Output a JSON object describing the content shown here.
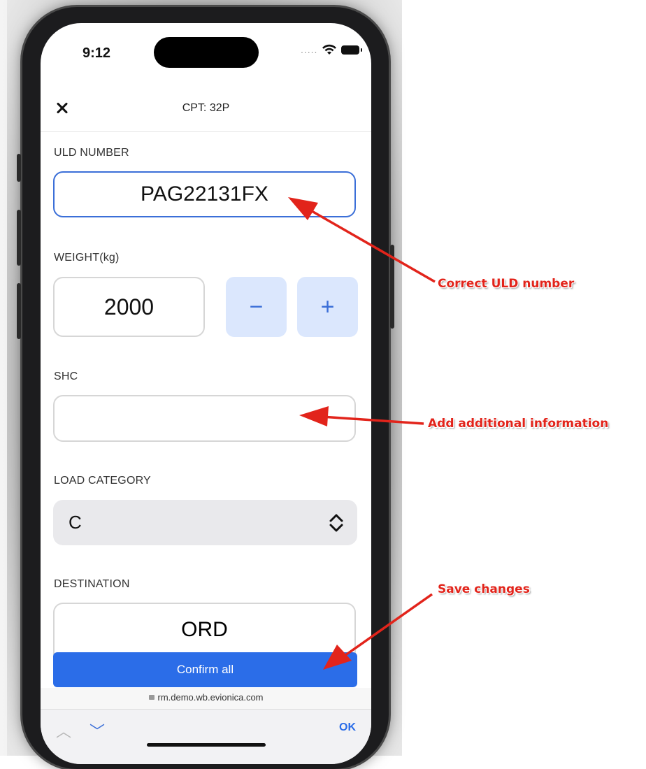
{
  "status_bar": {
    "time": "9:12",
    "signal_dots": "....."
  },
  "header": {
    "title": "CPT: 32P"
  },
  "uld": {
    "label": "ULD NUMBER",
    "value": "PAG22131FX"
  },
  "weight": {
    "label": "WEIGHT(kg)",
    "value": "2000",
    "minus": "−",
    "plus": "+"
  },
  "shc": {
    "label": "SHC",
    "value": ""
  },
  "load_category": {
    "label": "LOAD CATEGORY",
    "value": "C"
  },
  "destination": {
    "label": "DESTINATION",
    "value": "ORD"
  },
  "confirm": {
    "label": "Confirm all"
  },
  "browser": {
    "url": "rm.demo.wb.evionica.com",
    "up": "︿",
    "down": "﹀",
    "ok": "OK"
  },
  "annotations": {
    "correct_uld": "Correct ULD number",
    "add_info": "Add additional information",
    "save_changes": "Save changes"
  },
  "colors": {
    "accent": "#2b6de8",
    "annotation": "#e2241b",
    "stepper_bg": "#dbe7fd"
  }
}
